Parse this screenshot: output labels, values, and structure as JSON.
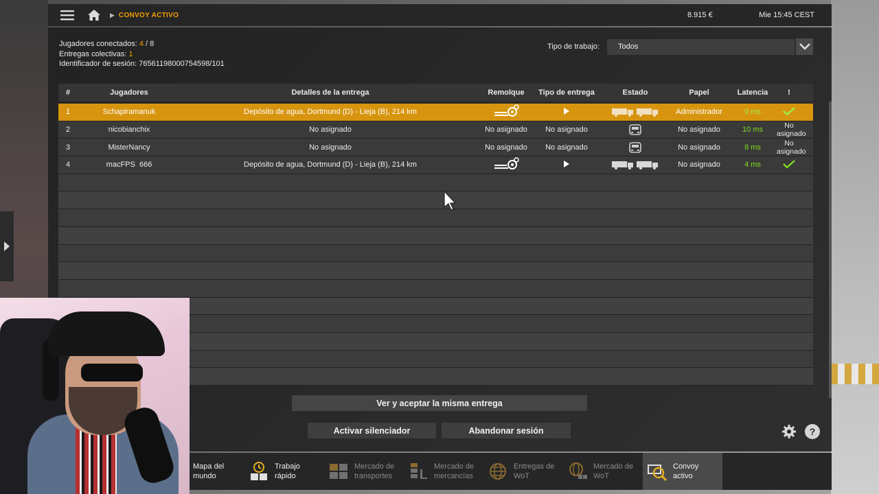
{
  "topbar": {
    "breadcrumb": "CONVOY ACTIVO",
    "money": "8.915 €",
    "clock": "Mie 15:45 CEST"
  },
  "info": {
    "players_label": "Jugadores conectados:",
    "players_current": "4",
    "players_sep": " / ",
    "players_max": "8",
    "deliveries_label": "Entregas colectivas:",
    "deliveries_value": "1",
    "session_label": "Identificador de sesión:",
    "session_value": "76561198000754598/101"
  },
  "filter": {
    "label": "Tipo de trabajo:",
    "value": "Todos"
  },
  "table": {
    "headers": {
      "num": "#",
      "players": "Jugadores",
      "details": "Detalles de la entrega",
      "trailer": "Remolque",
      "delivery_type": "Tipo de entrega",
      "status": "Estado",
      "role": "Papel",
      "latency": "Latencia",
      "alert": "!"
    },
    "rows": [
      {
        "num": "1",
        "player": "Schapiramanuk",
        "details": "Depósito de agua, Dortmund (D) - Lieja (B), 214 km",
        "trailer": "",
        "delivery_type": "",
        "role": "Administrador",
        "latency": "0 ms",
        "ready": ""
      },
      {
        "num": "2",
        "player": "nicobianchix",
        "details": "No asignado",
        "trailer": "No asignado",
        "delivery_type": "No asignado",
        "role": "No asignado",
        "latency": "10 ms",
        "ready": "No\nasignado"
      },
      {
        "num": "3",
        "player": "MisterNancy",
        "details": "No asignado",
        "trailer": "No asignado",
        "delivery_type": "No asignado",
        "role": "No asignado",
        "latency": "8 ms",
        "ready": "No\nasignado"
      },
      {
        "num": "4",
        "player": "macFPS  666",
        "details": "Depósito de agua, Dortmund (D) - Lieja (B), 214 km",
        "trailer": "",
        "delivery_type": "",
        "role": "No asignado",
        "latency": "4 ms",
        "ready": ""
      }
    ]
  },
  "buttons": {
    "accept": "Ver y aceptar la misma entrega",
    "mute": "Activar silenciador",
    "leave": "Abandonar sesión",
    "help": "?"
  },
  "bottomnav": [
    {
      "label": "Mapa del\nmundo",
      "icon": "world-map-icon"
    },
    {
      "label": "Trabajo\nrápido",
      "icon": "clock-boxes-icon"
    },
    {
      "label": "Mercado de\ntransportes",
      "icon": "transport-market-icon"
    },
    {
      "label": "Mercado de\nmercancías",
      "icon": "cargo-market-icon"
    },
    {
      "label": "Entregas de\nWoT",
      "icon": "globe-icon"
    },
    {
      "label": "Mercado de\nWoT",
      "icon": "globe-boxes-icon"
    },
    {
      "label": "Convoy\nactivo",
      "icon": "convoy-search-icon"
    }
  ],
  "colors": {
    "accent": "#d7950f",
    "latency_good": "#7fdc1f",
    "highlight_text": "#f0a000"
  }
}
